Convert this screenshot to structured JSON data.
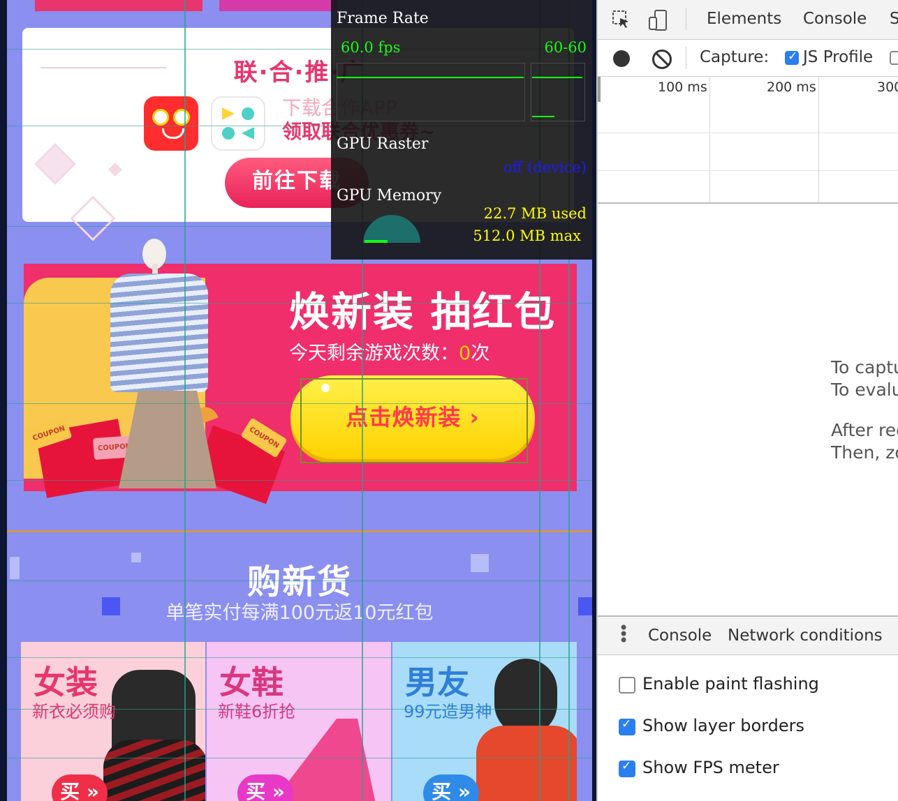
{
  "promo": {
    "title": "联·合·推·广",
    "app_line1": "下载合作APP",
    "app_line2": "领取联合优惠券~",
    "download_button": "前往下载"
  },
  "banner": {
    "title": "焕新装 抽红包",
    "remaining_prefix": "今天剩余游戏次数：",
    "remaining_count": "0",
    "remaining_suffix": "次",
    "cta": "点击焕新装 ›",
    "coupon_label": "COUPON"
  },
  "section": {
    "title": "购新货",
    "subtitle": "单笔实付每满100元返10元红包"
  },
  "categories": [
    {
      "title": "女装",
      "subtitle": "新衣必须购",
      "button": "买 »"
    },
    {
      "title": "女鞋",
      "subtitle": "新鞋6折抢",
      "button": "买 »"
    },
    {
      "title": "男友",
      "subtitle": "99元造男神",
      "button": "买 »"
    }
  ],
  "fps_meter": {
    "frame_rate_label": "Frame Rate",
    "fps": "60.0 fps",
    "range": "60-60",
    "gpu_raster_label": "GPU Raster",
    "gpu_raster_status": "off (device)",
    "gpu_memory_label": "GPU Memory",
    "memory_used": "22.7 MB used",
    "memory_max": "512.0 MB max",
    "memory_used_fraction": 0.044
  },
  "devtools": {
    "tabs": [
      "Elements",
      "Console",
      "S"
    ],
    "capture_label": "Capture:",
    "js_profile_label": "JS Profile",
    "js_profile_checked": true,
    "timeline_ticks": [
      "100 ms",
      "200 ms",
      "300"
    ],
    "message_lines": [
      "To captu",
      "To evalu",
      "After rec",
      "Then, zo"
    ],
    "drawer_tabs": [
      "Console",
      "Network conditions"
    ],
    "options": [
      {
        "label": "Enable paint flashing",
        "checked": false
      },
      {
        "label": "Show layer borders",
        "checked": true
      },
      {
        "label": "Show FPS meter",
        "checked": true
      }
    ]
  },
  "colors": {
    "page_bg": "#8a8ff0",
    "accent_pink": "#e8356d",
    "banner_red": "#ef2e6b",
    "cta_yellow": "#ffd200",
    "fps_green": "#14ff14",
    "devtools_blue": "#2a7ff0"
  }
}
